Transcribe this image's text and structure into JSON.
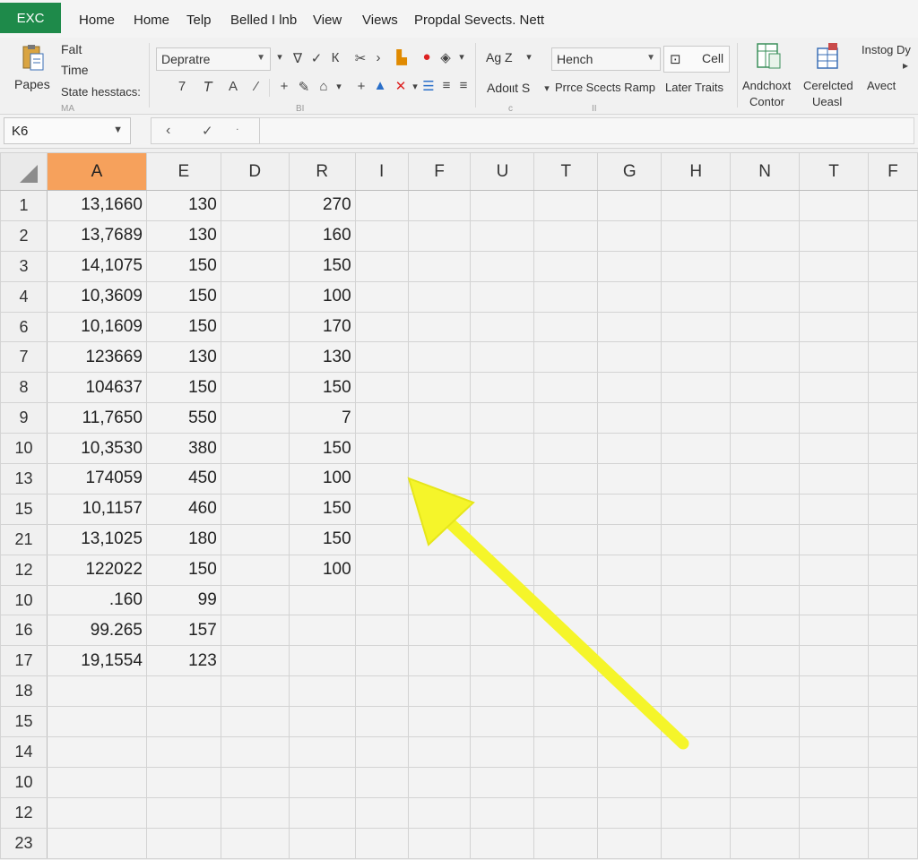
{
  "app": {
    "badge": "EXC"
  },
  "menu": [
    "Home",
    "Home",
    "Telp",
    "Belled I lnb",
    "View",
    "Views",
    "Propdal Sevects. Nett"
  ],
  "ribbon": {
    "paste_label": "Papes",
    "clipboard_lines": [
      "Falt",
      "Time",
      "State hesstacs:"
    ],
    "clipboard_group": "MA",
    "font_combo": "Depratre",
    "style_combo": "Hench",
    "cell_button": "Cell",
    "align_label": "Ag Z",
    "adout_label": "Adoιιt S",
    "price_label": "Prrce Scects Ramp",
    "later_traits": "Later Traits",
    "andchoxt": [
      "Andchoxt",
      "Contor"
    ],
    "cerelcted": [
      "Cerelcted",
      "Ueasl"
    ],
    "insting": "Instog Dy",
    "avect": "Avect",
    "group_mark": "BI"
  },
  "formula_bar": {
    "name_box": "K6"
  },
  "grid": {
    "columns": [
      "A",
      "E",
      "D",
      "R",
      "I",
      "F",
      "U",
      "T",
      "G",
      "H",
      "N",
      "T",
      "F"
    ],
    "active_column": "A",
    "rows": [
      {
        "num": "1",
        "a": "13,1660",
        "e": "130",
        "r": "270"
      },
      {
        "num": "2",
        "a": "13,7689",
        "e": "130",
        "r": "160"
      },
      {
        "num": "3",
        "a": "14,1075",
        "e": "150",
        "r": "150"
      },
      {
        "num": "4",
        "a": "10,3609",
        "e": "150",
        "r": "100"
      },
      {
        "num": "6",
        "a": "10,1609",
        "e": "150",
        "r": "170"
      },
      {
        "num": "7",
        "a": "123669",
        "e": "130",
        "r": "130"
      },
      {
        "num": "8",
        "a": "104637",
        "e": "150",
        "r": "150"
      },
      {
        "num": "9",
        "a": "11,7650",
        "e": "550",
        "r": "7"
      },
      {
        "num": "10",
        "a": "10,3530",
        "e": "380",
        "r": "150"
      },
      {
        "num": "13",
        "a": "174059",
        "e": "450",
        "r": "100"
      },
      {
        "num": "15",
        "a": "10,1157",
        "e": "460",
        "r": "150"
      },
      {
        "num": "21",
        "a": "13,1025",
        "e": "180",
        "r": "150"
      },
      {
        "num": "12",
        "a": "122022",
        "e": "150",
        "r": "100"
      },
      {
        "num": "10",
        "a": ".160",
        "e": "99",
        "r": ""
      },
      {
        "num": "16",
        "a": "99.265",
        "e": "157",
        "r": ""
      },
      {
        "num": "17",
        "a": "19,1554",
        "e": "123",
        "r": ""
      },
      {
        "num": "18",
        "a": "",
        "e": "",
        "r": ""
      },
      {
        "num": "15",
        "a": "",
        "e": "",
        "r": ""
      },
      {
        "num": "14",
        "a": "",
        "e": "",
        "r": ""
      },
      {
        "num": "10",
        "a": "",
        "e": "",
        "r": ""
      },
      {
        "num": "12",
        "a": "",
        "e": "",
        "r": ""
      },
      {
        "num": "23",
        "a": "",
        "e": "",
        "r": ""
      }
    ]
  },
  "colors": {
    "app_green": "#1e8a4a",
    "active_header": "#f6a15c",
    "arrow": "#f5f52a"
  }
}
